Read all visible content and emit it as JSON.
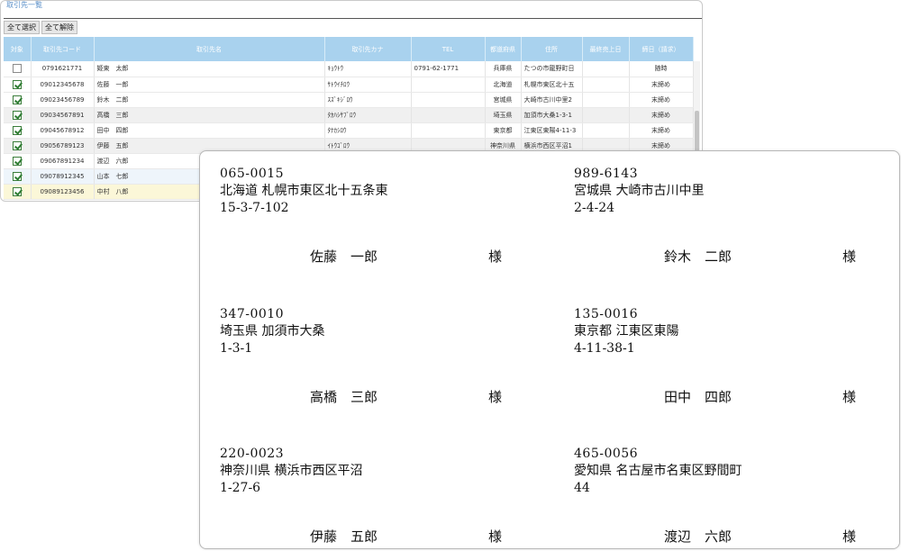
{
  "list_window": {
    "title": "取引先一覧",
    "select_all": "全て選択",
    "deselect_all": "全て解除",
    "columns": [
      "対象",
      "取引先コード",
      "取引先名",
      "取引先カナ",
      "TEL",
      "都道府県",
      "住所",
      "最終売上日",
      "締日（請求）"
    ],
    "rows": [
      {
        "checked": false,
        "code": "0791621771",
        "name": "姫東　太郎",
        "kana": "ｷｮｳﾄｳ",
        "tel": "0791-62-1771",
        "pref": "兵庫県",
        "addr": "たつの市龍野町日",
        "last": "",
        "close": "随時"
      },
      {
        "checked": true,
        "code": "09012345678",
        "name": "佐藤　一郎",
        "kana": "ｻﾄｳｲﾁﾛｳ",
        "tel": "",
        "pref": "北海道",
        "addr": "札幌市東区北十五",
        "last": "",
        "close": "末締め"
      },
      {
        "checked": true,
        "code": "09023456789",
        "name": "鈴木　二郎",
        "kana": "ｽｽﾞｷｼﾞﾛｳ",
        "tel": "",
        "pref": "宮城県",
        "addr": "大崎市古川中里2",
        "last": "",
        "close": "末締め"
      },
      {
        "checked": true,
        "code": "09034567891",
        "name": "高橋　三郎",
        "kana": "ﾀｶﾊｼｻﾌﾞﾛｳ",
        "tel": "",
        "pref": "埼玉県",
        "addr": "加須市大桑1-3-1",
        "last": "",
        "close": "末締め"
      },
      {
        "checked": true,
        "code": "09045678912",
        "name": "田中　四郎",
        "kana": "ﾀﾅｶｼﾛｳ",
        "tel": "",
        "pref": "東京都",
        "addr": "江東区東陽4-11-3",
        "last": "",
        "close": "末締め"
      },
      {
        "checked": true,
        "code": "09056789123",
        "name": "伊藤　五郎",
        "kana": "ｲﾄｳｺﾞﾛｳ",
        "tel": "",
        "pref": "神奈川県",
        "addr": "横浜市西区平沼1",
        "last": "",
        "close": "末締め"
      },
      {
        "checked": true,
        "code": "09067891234",
        "name": "渡辺　六郎",
        "kana": "",
        "tel": "",
        "pref": "",
        "addr": "",
        "last": "",
        "close": ""
      },
      {
        "checked": true,
        "code": "09078912345",
        "name": "山本　七郎",
        "kana": "",
        "tel": "",
        "pref": "",
        "addr": "",
        "last": "",
        "close": ""
      },
      {
        "checked": true,
        "code": "09089123456",
        "name": "中村　八郎",
        "kana": "",
        "tel": "",
        "pref": "",
        "addr": "",
        "last": "",
        "close": ""
      }
    ]
  },
  "labels": [
    {
      "zip": "065-0015",
      "addr1": "北海道  札幌市東区北十五条東",
      "addr2": "15-3-7-102",
      "name": "佐藤　一郎",
      "honorific": "様"
    },
    {
      "zip": "989-6143",
      "addr1": "宮城県  大崎市古川中里",
      "addr2": "2-4-24",
      "name": "鈴木　二郎",
      "honorific": "様"
    },
    {
      "zip": "347-0010",
      "addr1": "埼玉県  加須市大桑",
      "addr2": "1-3-1",
      "name": "高橋　三郎",
      "honorific": "様"
    },
    {
      "zip": "135-0016",
      "addr1": "東京都  江東区東陽",
      "addr2": "4-11-38-1",
      "name": "田中　四郎",
      "honorific": "様"
    },
    {
      "zip": "220-0023",
      "addr1": "神奈川県  横浜市西区平沼",
      "addr2": "1-27-6",
      "name": "伊藤　五郎",
      "honorific": "様"
    },
    {
      "zip": "465-0056",
      "addr1": "愛知県  名古屋市名東区野間町",
      "addr2": "44",
      "name": "渡辺　六郎",
      "honorific": "様"
    }
  ]
}
